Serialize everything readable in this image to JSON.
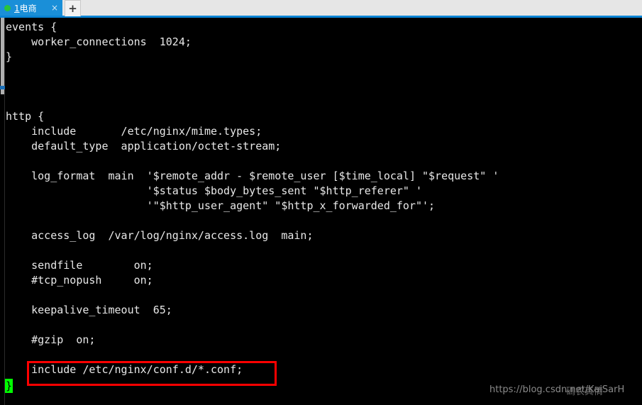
{
  "window": {
    "tab": {
      "status_dot": "green-status-dot",
      "number": "1",
      "title": "电商",
      "close_label": "×"
    },
    "new_tab_label": "+"
  },
  "terminal": {
    "lines": [
      "events {",
      "    worker_connections  1024;",
      "}",
      "",
      "",
      "",
      "http {",
      "    include       /etc/nginx/mime.types;",
      "    default_type  application/octet-stream;",
      "",
      "    log_format  main  '$remote_addr - $remote_user [$time_local] \"$request\" '",
      "                      '$status $body_bytes_sent \"$http_referer\" '",
      "                      '\"$http_user_agent\" \"$http_x_forwarded_for\"';",
      "",
      "    access_log  /var/log/nginx/access.log  main;",
      "",
      "    sendfile        on;",
      "    #tcp_nopush     on;",
      "",
      "    keepalive_timeout  65;",
      "",
      "    #gzip  on;",
      "",
      "    include /etc/nginx/conf.d/*.conf;"
    ],
    "cursor_char": "}",
    "highlight": {
      "text": "include /etc/nginx/conf.d/*.conf;",
      "color": "#ff0000"
    }
  },
  "watermark": {
    "url": "https://blog.csdn.net/KaiSarH",
    "overlay": "碼农真情"
  },
  "colors": {
    "tab_active": "#1a8fd8",
    "tab_bar": "#e6e6e6",
    "terminal_bg": "#000000",
    "terminal_fg": "#e8e8e8",
    "cursor": "#00ff00",
    "accent": "#0a84d4"
  }
}
